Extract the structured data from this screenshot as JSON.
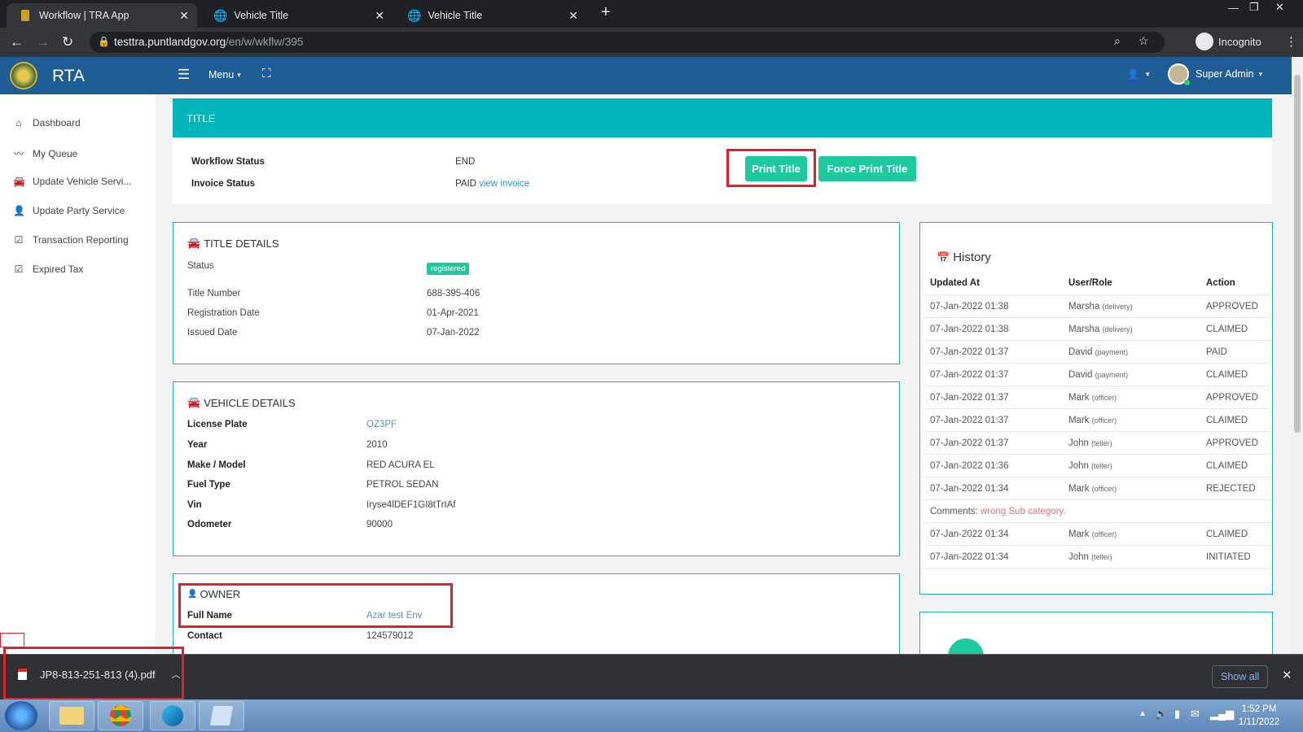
{
  "browser": {
    "tabs": [
      {
        "title": "Workflow | TRA App",
        "active": true
      },
      {
        "title": "Vehicle Title",
        "active": false
      },
      {
        "title": "Vehicle Title",
        "active": false
      }
    ],
    "url_domain": "testtra.puntlandgov.org",
    "url_path": "/en/w/wkflw/395",
    "profile_label": "Incognito"
  },
  "header": {
    "brand": "RTA",
    "menu_label": "Menu",
    "user_name": "Super Admin"
  },
  "sidebar": {
    "items": [
      {
        "label": "Dashboard",
        "icon": "home-icon"
      },
      {
        "label": "My Queue",
        "icon": "trend-icon"
      },
      {
        "label": "Update Vehicle Servi...",
        "icon": "car-icon"
      },
      {
        "label": "Update Party Service",
        "icon": "user-icon"
      },
      {
        "label": "Transaction Reporting",
        "icon": "check-square-icon"
      },
      {
        "label": "Expired Tax",
        "icon": "check-square-icon"
      }
    ]
  },
  "title_panel": {
    "heading": "TITLE",
    "workflow_status_label": "Workflow Status",
    "workflow_status_value": "END",
    "invoice_status_label": "Invoice Status",
    "invoice_status_value": "PAID",
    "view_invoice_link": "view invoice",
    "print_title_button": "Print Title",
    "force_print_button": "Force Print Title"
  },
  "title_details": {
    "heading": "TITLE DETAILS",
    "status_label": "Status",
    "status_badge": "registered",
    "rows": [
      {
        "label": "Title Number",
        "value": "688-395-406"
      },
      {
        "label": "Registration Date",
        "value": "01-Apr-2021"
      },
      {
        "label": "Issued Date",
        "value": "07-Jan-2022"
      }
    ]
  },
  "vehicle_details": {
    "heading": "VEHICLE DETAILS",
    "rows": [
      {
        "label": "License Plate",
        "value": "OZ3PF"
      },
      {
        "label": "Year",
        "value": "2010"
      },
      {
        "label": "Make / Model",
        "value": "RED ACURA EL"
      },
      {
        "label": "Fuel Type",
        "value": "PETROL SEDAN"
      },
      {
        "label": "Vin",
        "value": "Iryse4lDEF1GI8tTrIAf"
      },
      {
        "label": "Odometer",
        "value": "90000"
      }
    ]
  },
  "owner": {
    "heading": "OWNER",
    "full_name_label": "Full Name",
    "full_name_value": "Azar test Env",
    "contact_label": "Contact",
    "contact_value": "124579012"
  },
  "history": {
    "heading": "History",
    "columns": [
      "Updated At",
      "User/Role",
      "Action"
    ],
    "rows": [
      {
        "updated_at": "07-Jan-2022 01:38",
        "user": "Marsha",
        "role": "(delivery)",
        "action": "APPROVED"
      },
      {
        "updated_at": "07-Jan-2022 01:38",
        "user": "Marsha",
        "role": "(delivery)",
        "action": "CLAIMED"
      },
      {
        "updated_at": "07-Jan-2022 01:37",
        "user": "David",
        "role": "(payment)",
        "action": "PAID"
      },
      {
        "updated_at": "07-Jan-2022 01:37",
        "user": "David",
        "role": "(payment)",
        "action": "CLAIMED"
      },
      {
        "updated_at": "07-Jan-2022 01:37",
        "user": "Mark",
        "role": "(officer)",
        "action": "APPROVED"
      },
      {
        "updated_at": "07-Jan-2022 01:37",
        "user": "Mark",
        "role": "(officer)",
        "action": "CLAIMED"
      },
      {
        "updated_at": "07-Jan-2022 01:37",
        "user": "John",
        "role": "(teller)",
        "action": "APPROVED"
      },
      {
        "updated_at": "07-Jan-2022 01:36",
        "user": "John",
        "role": "(teller)",
        "action": "CLAIMED"
      },
      {
        "updated_at": "07-Jan-2022 01:34",
        "user": "Mark",
        "role": "(officer)",
        "action": "REJECTED"
      }
    ],
    "comment_label": "Comments:",
    "comment_text": "wrong Sub category.",
    "rows_after": [
      {
        "updated_at": "07-Jan-2022 01:34",
        "user": "Mark",
        "role": "(officer)",
        "action": "CLAIMED"
      },
      {
        "updated_at": "07-Jan-2022 01:34",
        "user": "John",
        "role": "(teller)",
        "action": "INITIATED"
      }
    ]
  },
  "download_bar": {
    "file_name": "JP8-813-251-813 (4).pdf",
    "show_all": "Show all"
  },
  "taskbar": {
    "time": "1:52 PM",
    "date": "1/11/2022"
  },
  "colors": {
    "header_blue": "#1f5d96",
    "teal": "#00b4b9",
    "green_button": "#1dc99f",
    "highlight_red": "#e0202a"
  }
}
